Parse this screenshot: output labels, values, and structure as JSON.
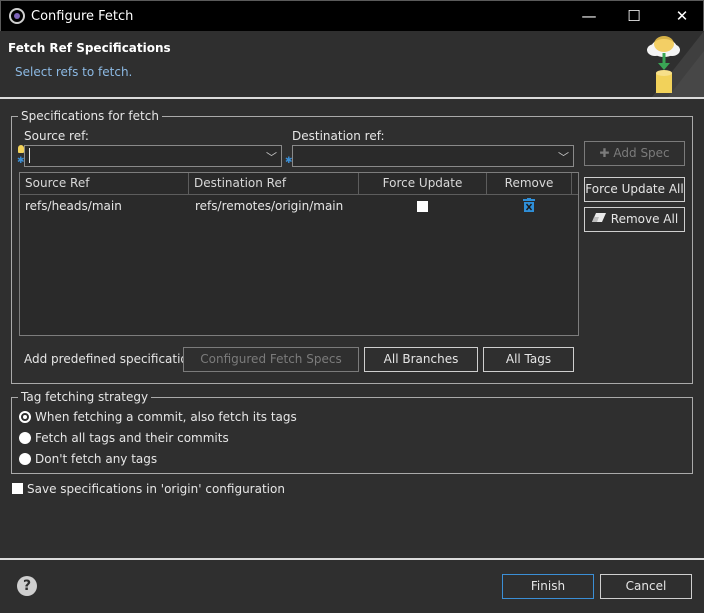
{
  "window": {
    "title": "Configure Fetch",
    "controls": [
      "—",
      "☐",
      "✕"
    ]
  },
  "header": {
    "title": "Fetch Ref Specifications",
    "subtitle": "Select refs to fetch."
  },
  "specs": {
    "legend": "Specifications for fetch",
    "source_label": "Source ref:",
    "source_value": "",
    "destination_label": "Destination ref:",
    "destination_value": "",
    "add_spec": "Add Spec",
    "force_update_all": "Force Update All",
    "remove_all": "Remove All",
    "columns": [
      "Source Ref",
      "Destination Ref",
      "Force Update",
      "Remove"
    ],
    "rows": [
      {
        "source": "refs/heads/main",
        "destination": "refs/remotes/origin/main",
        "force_update": false
      }
    ],
    "predefined_label": "Add predefined specification",
    "configured_fetch_specs": "Configured Fetch Specs",
    "all_branches": "All Branches",
    "all_tags": "All Tags"
  },
  "tags": {
    "legend": "Tag fetching strategy",
    "options": [
      {
        "label": "When fetching a commit, also fetch its tags",
        "selected": true
      },
      {
        "label": "Fetch all tags and their commits",
        "selected": false
      },
      {
        "label": "Don't fetch any tags",
        "selected": false
      }
    ]
  },
  "save": {
    "label": "Save specifications in 'origin' configuration",
    "checked": false
  },
  "footer": {
    "finish": "Finish",
    "cancel": "Cancel",
    "help_glyph": "?"
  },
  "colors": {
    "accent": "#3b8fd6",
    "link_text": "#8cb9e3",
    "background": "#2f2f2f"
  },
  "icons": [
    "app-icon",
    "fetch-banner-icon",
    "content-assist-bulb-icon",
    "required-marker-icon",
    "chevron-down-icon",
    "plus-icon",
    "eraser-icon",
    "trash-icon",
    "help-icon"
  ]
}
